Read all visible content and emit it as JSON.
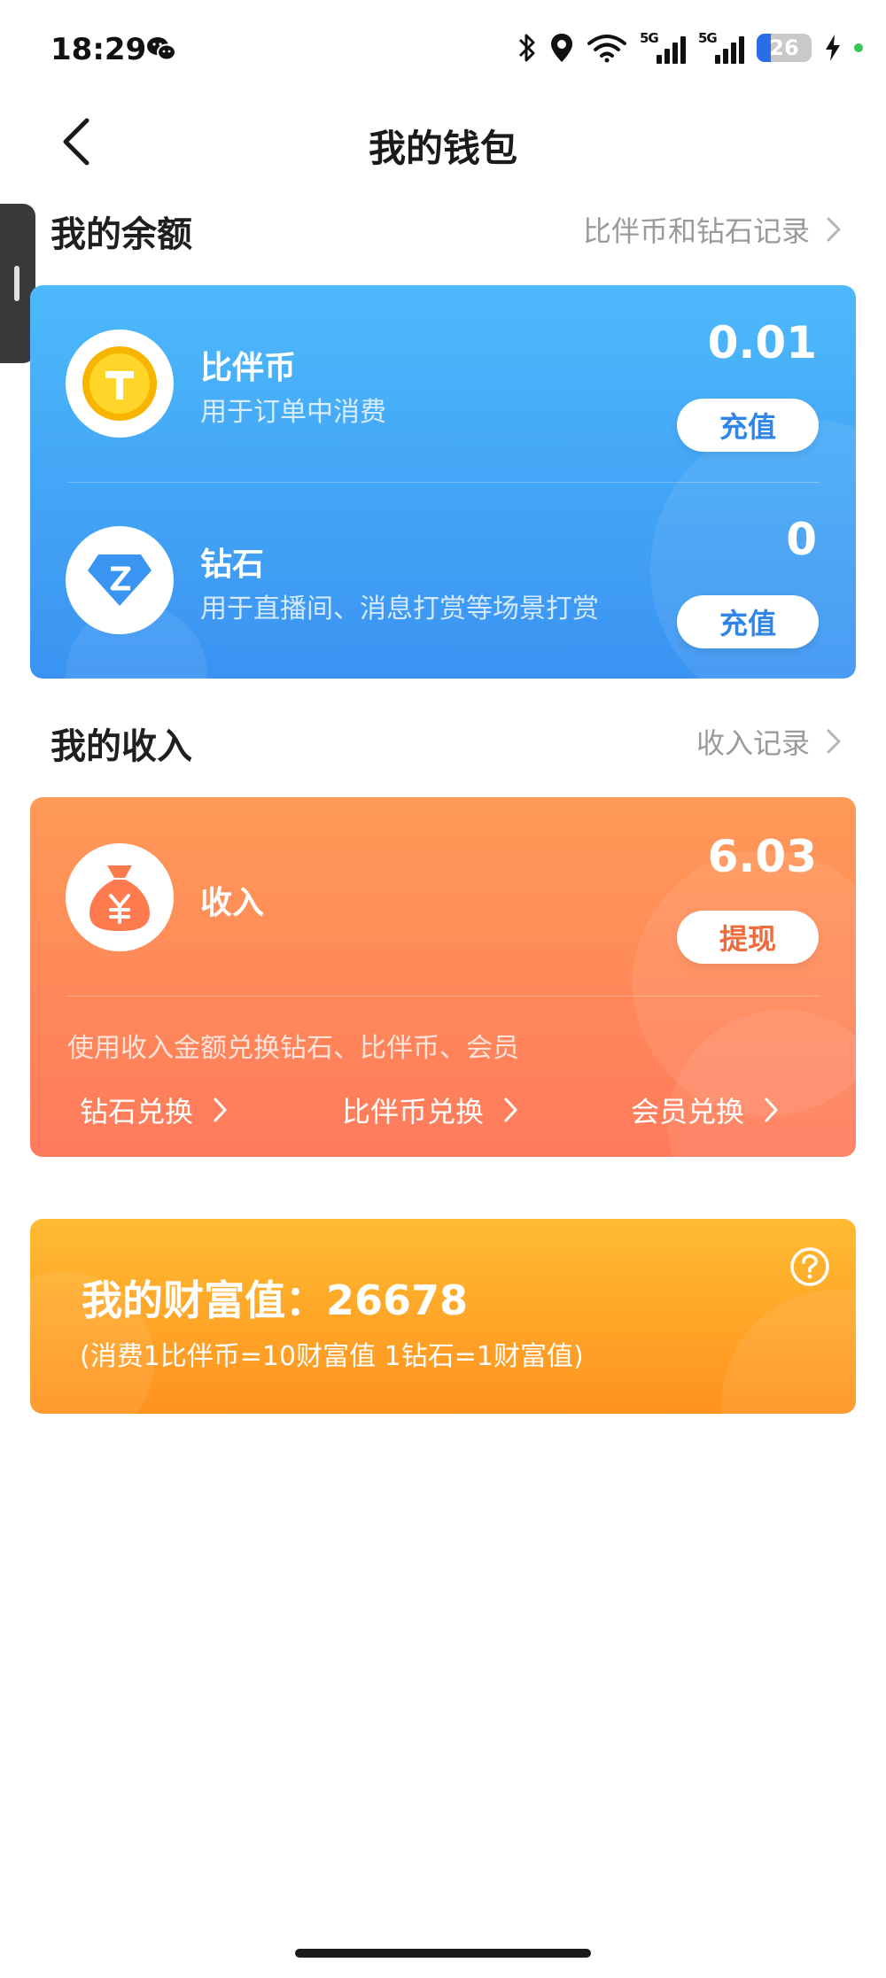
{
  "status_bar": {
    "time": "18:29",
    "net1_tag": "5G",
    "net2_tag": "5G",
    "battery_level": "26",
    "battery_fraction": 0.26,
    "accent_battery": "#2b6de8"
  },
  "header": {
    "title": "我的钱包",
    "back_icon": "chevron-left-icon"
  },
  "balance_section": {
    "title": "我的余额",
    "link": "比伴币和钻石记录",
    "items": [
      {
        "name": "比伴币",
        "desc": "用于订单中消费",
        "amount": "0.01",
        "button": "充值",
        "icon": "coin-icon"
      },
      {
        "name": "钻石",
        "desc": "用于直播间、消息打赏等场景打赏",
        "amount": "0",
        "button": "充值",
        "icon": "diamond-icon"
      }
    ],
    "color": "#3a93f2"
  },
  "income_section": {
    "title": "我的收入",
    "link": "收入记录",
    "name": "收入",
    "amount": "6.03",
    "button": "提现",
    "note": "使用收入金额兑换钻石、比伴币、会员",
    "exchanges": [
      "钻石兑换",
      "比伴币兑换",
      "会员兑换"
    ],
    "icon": "money-bag-icon",
    "color": "#ff7a5c"
  },
  "wealth_section": {
    "title": "我的财富值：26678",
    "note": "(消费1比伴币=10财富值 1钻石=1财富值)",
    "help_icon": "question-circle-icon",
    "color": "#ff921f"
  }
}
